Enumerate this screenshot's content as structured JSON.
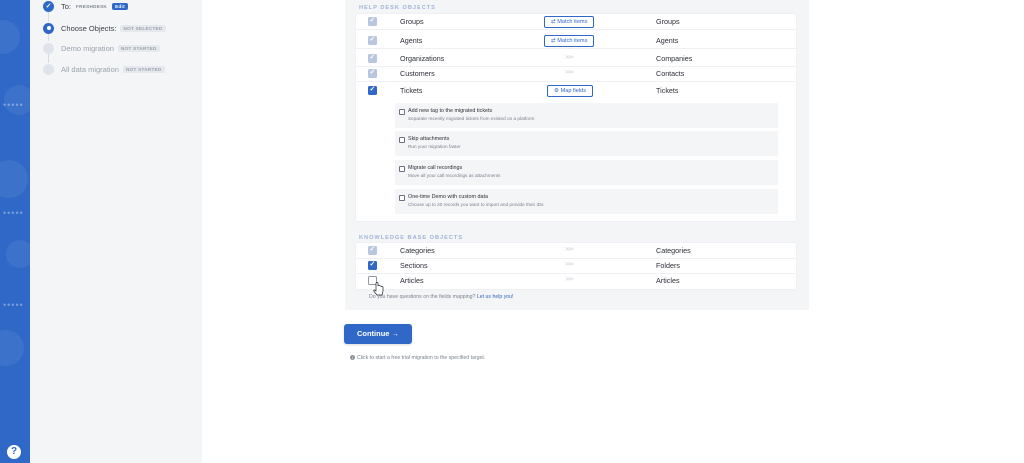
{
  "steps": [
    {
      "label": "To:",
      "badge_brand": "FRESHDESK",
      "badge": "Edit",
      "state": "done"
    },
    {
      "label": "Choose Objects:",
      "badge": "NOT SELECTED",
      "state": "current"
    },
    {
      "label": "Demo migration",
      "badge": "NOT STARTED",
      "state": "todo"
    },
    {
      "label": "All data migration",
      "badge": "NOT STARTED",
      "state": "todo"
    }
  ],
  "help_desk": {
    "title": "HELP DESK OBJECTS",
    "rows": [
      {
        "source": "Groups",
        "target": "Groups",
        "action": "⇄ Match items",
        "checked": "disabled"
      },
      {
        "source": "Agents",
        "target": "Agents",
        "action": "⇄ Match items",
        "checked": "disabled"
      },
      {
        "source": "Organizations",
        "target": "Companies",
        "arrows": ">>>",
        "checked": "disabled"
      },
      {
        "source": "Customers",
        "target": "Contacts",
        "arrows": ">>>",
        "checked": "disabled"
      },
      {
        "source": "Tickets",
        "target": "Tickets",
        "action": "⚙ Map fields",
        "checked": "on"
      }
    ],
    "ticket_options": [
      {
        "title": "Add new tag to the migrated tickets",
        "desc": "Separate recently migrated tickets from existed on a platform"
      },
      {
        "title": "Skip attachments",
        "desc": "Run your migration faster"
      },
      {
        "title": "Migrate call recordings",
        "desc": "Move all your call recordings as attachments"
      },
      {
        "title": "One-time Demo with custom data",
        "desc": "Choose up to 20 records you want to import and provide their IDs"
      }
    ]
  },
  "knowledge_base": {
    "title": "KNOWLEDGE BASE OBJECTS",
    "rows": [
      {
        "source": "Categories",
        "target": "Categories",
        "arrows": ">>>",
        "checked": "disabled"
      },
      {
        "source": "Sections",
        "target": "Folders",
        "arrows": ">>>",
        "checked": "on"
      },
      {
        "source": "Articles",
        "target": "Articles",
        "arrows": ">>>",
        "checked": "off"
      }
    ]
  },
  "hint": {
    "text": "Do you have questions on the fields mapping?",
    "link": "Let us help you!"
  },
  "continue_label": "Continue →",
  "footer_note": "Click to start a free trial migration to the specified target.",
  "rail_help": "?",
  "colors": {
    "accent": "#2f68c6",
    "panel": "#f4f5f7"
  }
}
